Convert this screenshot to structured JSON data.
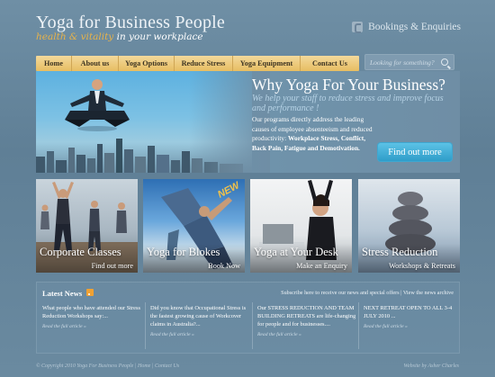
{
  "header": {
    "title": "Yoga for Business People",
    "tagline_part1": "health & vitality",
    "tagline_part2": "in your workplace",
    "bookings_label": "Bookings & Enquiries"
  },
  "nav": {
    "items": [
      "Home",
      "About us",
      "Yoga Options",
      "Reduce Stress",
      "Yoga Equipment",
      "Contact Us"
    ]
  },
  "search": {
    "placeholder": "Looking for something?"
  },
  "hero": {
    "title": "Why Yoga For Your Business?",
    "subtitle": "We help your staff to reduce stress and improve focus and performance !",
    "body_intro": "Our programs directly address the leading causes of employee absenteeism and reduced productivity: ",
    "body_bold": "Workplace Stress, Conflict, Back Pain, Fatigue and Demotivation.",
    "button": "Find out more"
  },
  "tiles": [
    {
      "title": "Corporate Classes",
      "sub": "Find out more"
    },
    {
      "title": "Yoga for Blokes",
      "sub": "Book Now",
      "badge": "NEW"
    },
    {
      "title": "Yoga at Your Desk",
      "sub": "Make an Enquiry"
    },
    {
      "title": "Stress Reduction",
      "sub": "Workshops & Retreats"
    }
  ],
  "news": {
    "title": "Latest News",
    "subscribe": "Subscribe here to receive our news and special offers | View the news archive",
    "items": [
      {
        "text": "What people who have attended our Stress Reduction Workshops say:...",
        "readmore": "Read the full article »"
      },
      {
        "text": "Did you know that Occupational Stress is the fastest growing cause of Workcover claims in Australia?...",
        "readmore": "Read the full article »"
      },
      {
        "text": "Our STRESS REDUCTION AND TEAM BUILDING RETREATS are life-changing for people and for businesses....",
        "readmore": "Read the full article »"
      },
      {
        "text": "NEXT RETREAT OPEN TO ALL 3-4 JULY 2010 ...",
        "readmore": "Read the full article »"
      }
    ]
  },
  "footer": {
    "left": "© Copyright 2010 Yoga For Business People | Home | Contact Us",
    "right": "Website by Asher Charles"
  }
}
